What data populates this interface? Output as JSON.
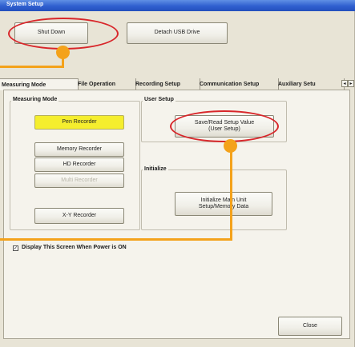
{
  "window": {
    "title": "System Setup"
  },
  "toolbar": {
    "shutdown_label": "Shut Down",
    "detach_label": "Detach USB Drive"
  },
  "tabs": [
    {
      "label": "Measuring Mode",
      "active": true
    },
    {
      "label": "File Operation",
      "active": false
    },
    {
      "label": "Recording Setup",
      "active": false
    },
    {
      "label": "Communication Setup",
      "active": false
    },
    {
      "label": "Auxiliary Setu",
      "active": false
    }
  ],
  "tab_scroll": {
    "left_icon": "◂",
    "right_icon": "▸"
  },
  "measuring_mode": {
    "group_label": "Measuring Mode",
    "modes": [
      {
        "label": "Pen Recorder",
        "selected": true,
        "enabled": true
      },
      {
        "label": "Memory Recorder",
        "selected": false,
        "enabled": true
      },
      {
        "label": "HD Recorder",
        "selected": false,
        "enabled": true
      },
      {
        "label": "Multi Recorder",
        "selected": false,
        "enabled": false
      },
      {
        "label": "X-Y Recorder",
        "selected": false,
        "enabled": true
      }
    ]
  },
  "user_setup": {
    "group_label": "User Setup",
    "button_line1": "Save/Read Setup Value",
    "button_line2": "(User Setup)"
  },
  "initialize": {
    "group_label": "Initialize",
    "button_line1": "Initialize Main Unit",
    "button_line2": "Setup/Memory Data"
  },
  "options": {
    "display_on_power_label": "Display This Screen When Power is ON",
    "display_on_power_checked": true
  },
  "footer": {
    "close_label": "Close"
  },
  "annotation_colors": {
    "ring": "#d8262a",
    "marker": "#f4a21b"
  }
}
